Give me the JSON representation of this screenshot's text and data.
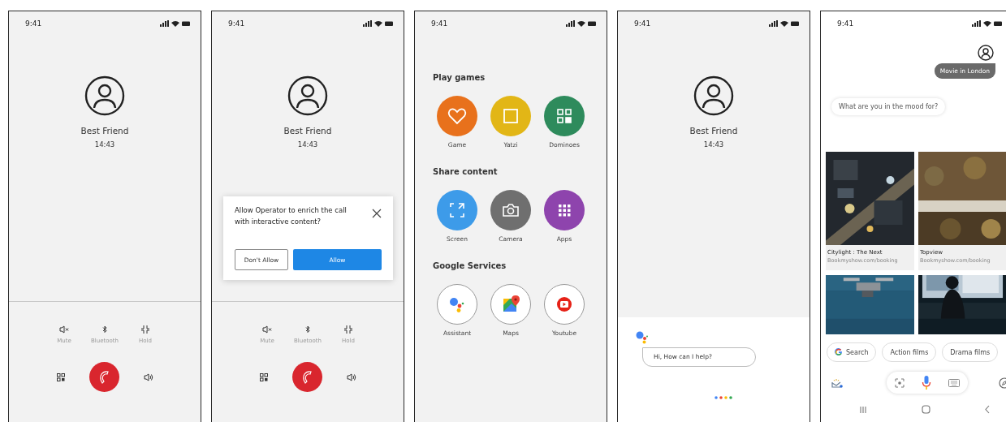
{
  "screens": [
    {
      "kind": "call",
      "time": "9:41",
      "contact": {
        "name": "Best Friend",
        "duration": "14:43"
      },
      "controls": [
        {
          "kind": "mute",
          "label": "Mute"
        },
        {
          "kind": "bluetooth",
          "label": "Bluetooth"
        },
        {
          "kind": "hold",
          "label": "Hold"
        }
      ]
    },
    {
      "kind": "call",
      "time": "9:41",
      "contact": {
        "name": "Best Friend",
        "duration": "14:43"
      },
      "controls": [
        {
          "kind": "mute",
          "label": "Mute"
        },
        {
          "kind": "bluetooth",
          "label": "Bluetooth"
        },
        {
          "kind": "hold",
          "label": "Hold"
        }
      ],
      "dialog": {
        "message": "Allow Operator to enrich the call with interactive content?",
        "buttons": [
          {
            "kind": "outline",
            "label": "Don't Allow"
          },
          {
            "kind": "primary",
            "label": "Allow"
          }
        ]
      }
    },
    {
      "kind": "menu",
      "time": "9:41",
      "sections": [
        {
          "title": "Play games",
          "items": [
            {
              "kind": "heart",
              "label": "Game",
              "color": "#e8711c"
            },
            {
              "kind": "square",
              "label": "Yatzi",
              "color": "#e2b616"
            },
            {
              "kind": "grid",
              "label": "Dominoes",
              "color": "#2e8b5c"
            }
          ]
        },
        {
          "title": "Share content",
          "items": [
            {
              "kind": "screen",
              "label": "Screen",
              "color": "#3d9be9"
            },
            {
              "kind": "camera",
              "label": "Camera",
              "color": "#6f6f6f"
            },
            {
              "kind": "apps",
              "label": "Apps",
              "color": "#8e44ad"
            }
          ]
        },
        {
          "title": "Google Services",
          "items": [
            {
              "kind": "assistant",
              "label": "Assistant"
            },
            {
              "kind": "maps",
              "label": "Maps"
            },
            {
              "kind": "youtube",
              "label": "Youtube"
            }
          ]
        }
      ]
    },
    {
      "kind": "assistant",
      "time": "9:41",
      "contact": {
        "name": "Best Friend",
        "duration": "14:43"
      },
      "prompt": "Hi, How can I help?"
    },
    {
      "kind": "results",
      "time": "9:41",
      "query": "Movie in London",
      "question": "What are you in the mood for?",
      "results": [
        {
          "kind": "captioned",
          "title": "Citylight : The Next",
          "source": "Bookmyshow.com/booking"
        },
        {
          "kind": "captioned",
          "title": "Topview",
          "source": "Bookmyshow.com/booking"
        },
        {
          "kind": "picture"
        },
        {
          "kind": "picture"
        }
      ],
      "chips": [
        {
          "kind": "google",
          "label": "Search"
        },
        {
          "kind": "plain",
          "label": "Action films"
        },
        {
          "kind": "plain",
          "label": "Drama films"
        }
      ]
    }
  ]
}
